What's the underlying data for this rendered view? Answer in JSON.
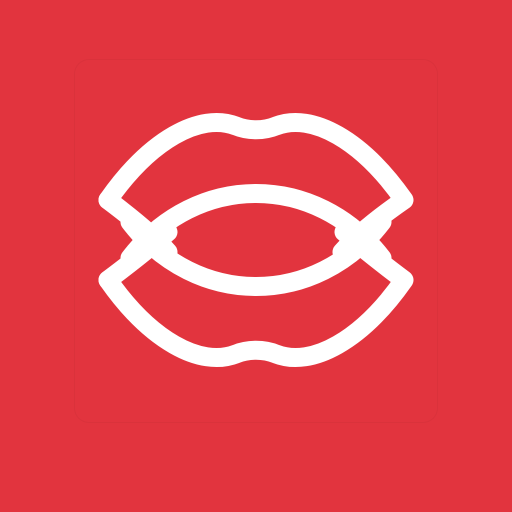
{
  "app": {
    "icon_name": "double-lips-logo-icon",
    "background_color": "#E2343E",
    "mark_color": "#FFFFFF"
  }
}
